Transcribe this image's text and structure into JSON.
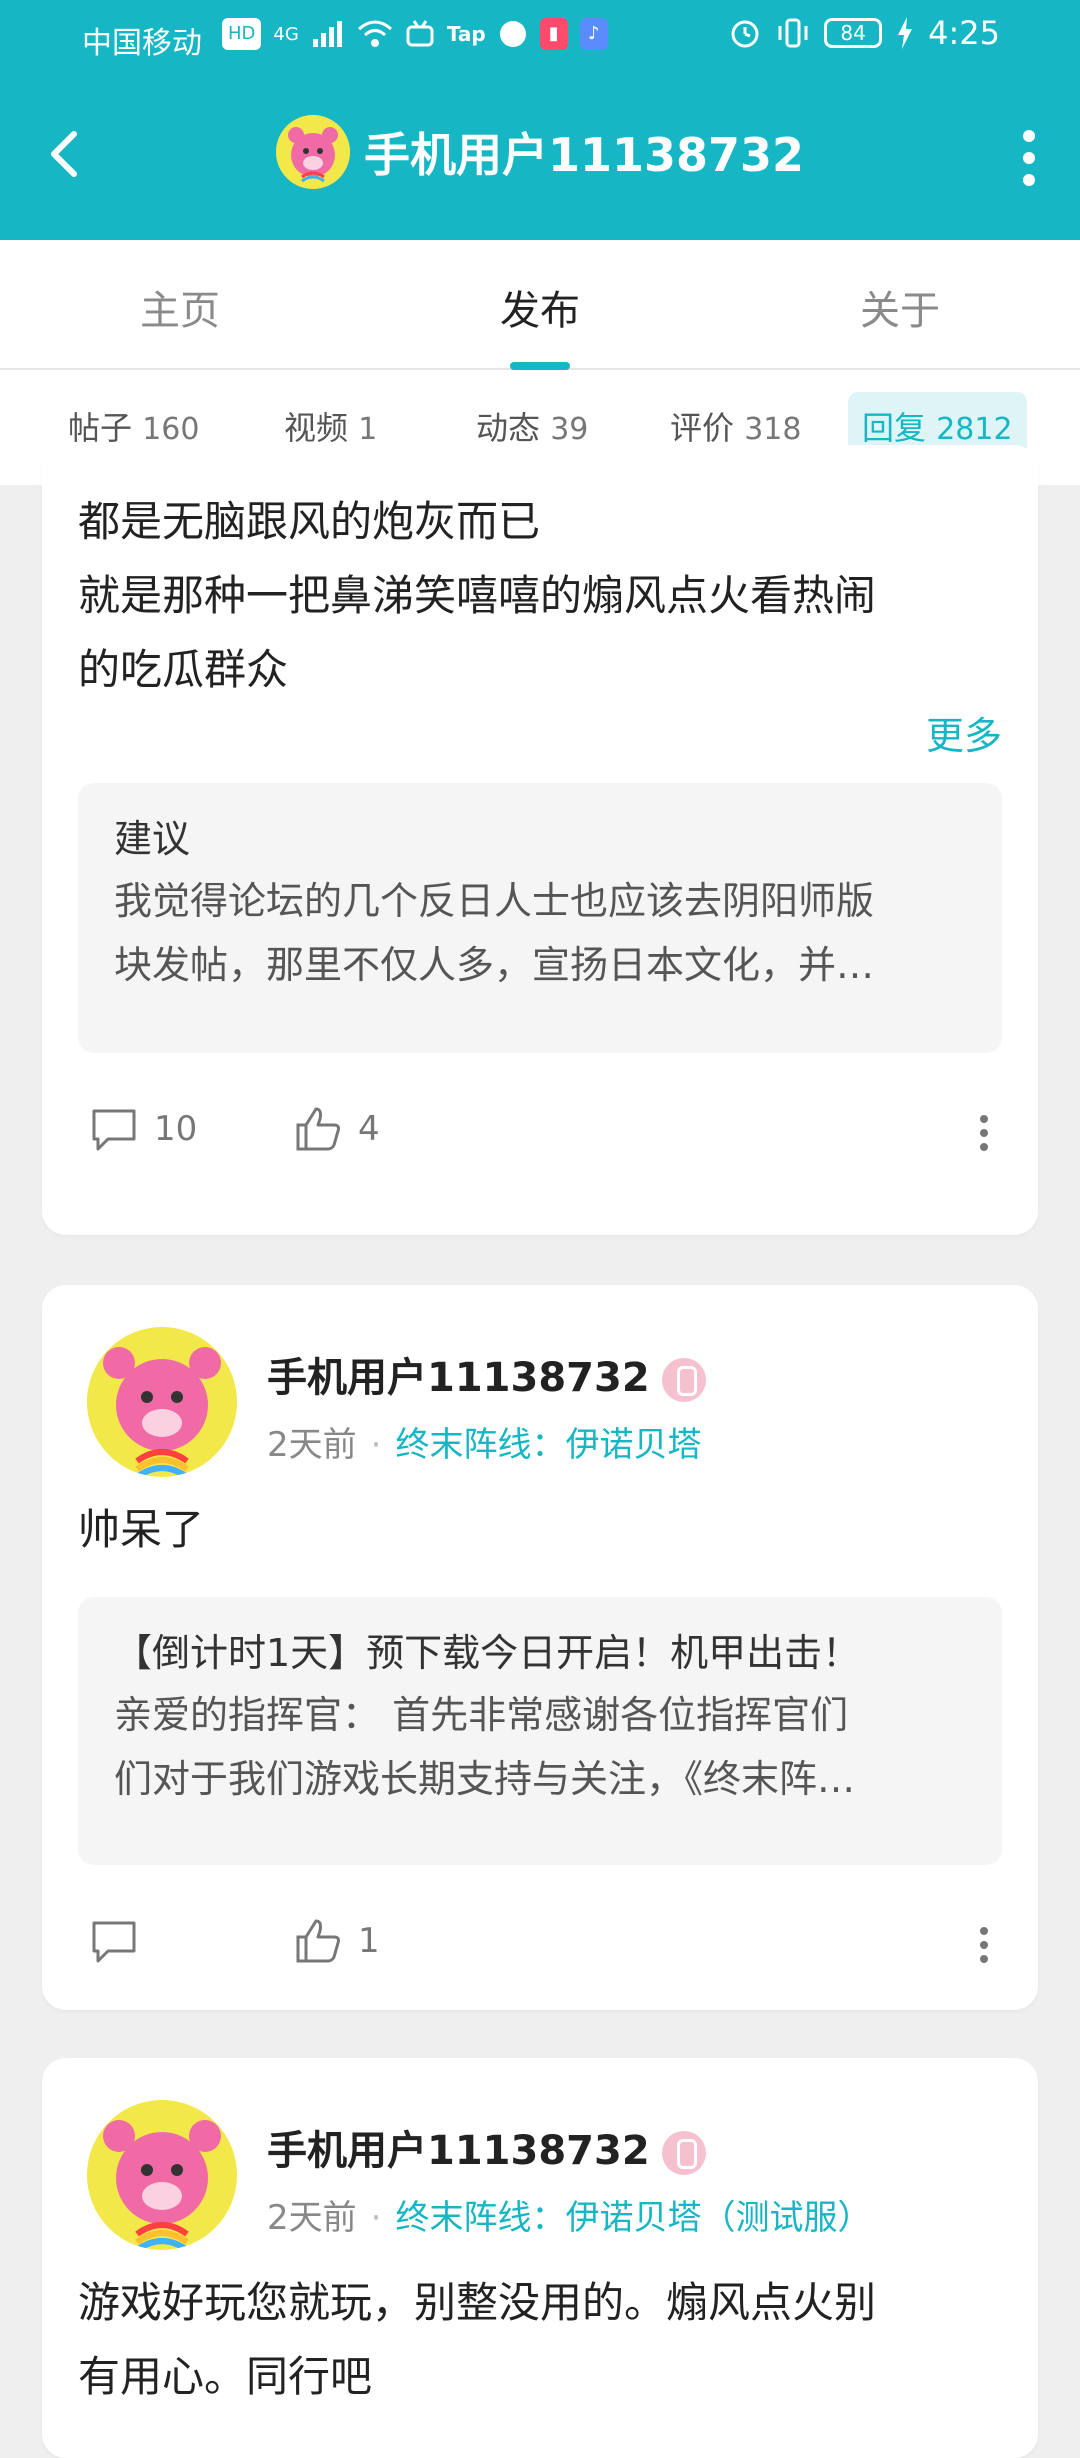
{
  "status_bar": {
    "carrier": "中国移动",
    "hd": "HD",
    "network": "4G",
    "tap_label": "Tap",
    "battery": "84",
    "time": "4:25"
  },
  "header": {
    "title": "手机用户11138732",
    "back_icon": "back-arrow-icon",
    "more_icon": "more-vertical-icon"
  },
  "tabs": [
    {
      "label": "主页"
    },
    {
      "label": "发布"
    },
    {
      "label": "关于"
    }
  ],
  "subtabs": [
    {
      "label": "帖子",
      "count": "160"
    },
    {
      "label": "视频",
      "count": "1"
    },
    {
      "label": "动态",
      "count": "39"
    },
    {
      "label": "评价",
      "count": "318"
    },
    {
      "label": "回复",
      "count": "2812"
    }
  ],
  "posts": [
    {
      "text_lines": [
        "都是无脑跟风的炮灰而已",
        "就是那种一把鼻涕笑嘻嘻的煽风点火看热闹",
        "的吃瓜群众"
      ],
      "more": "更多",
      "quote_title": "建议",
      "quote_lines": [
        "我觉得论坛的几个反日人士也应该去阴阳师版",
        "块发帖，那里不仅人多，宣扬日本文化，并…"
      ],
      "comments": "10",
      "likes": "4"
    },
    {
      "username": "手机用户11138732",
      "time": "2天前",
      "forum": "终末阵线：伊诺贝塔",
      "text_lines": [
        "帅呆了"
      ],
      "quote_title": "【倒计时1天】预下载今日开启！机甲出击！",
      "quote_lines": [
        "亲爱的指挥官：  首先非常感谢各位指挥官们",
        "们对于我们游戏长期支持与关注，《终末阵…"
      ],
      "comments": "",
      "likes": "1"
    },
    {
      "username": "手机用户11138732",
      "time": "2天前",
      "forum": "终末阵线：伊诺贝塔（测试服）",
      "text_lines": [
        "游戏好玩您就玩，别整没用的。煽风点火别",
        "有用心。同行吧"
      ]
    }
  ],
  "colors": {
    "accent": "#16b6c5",
    "background": "#efefef"
  }
}
